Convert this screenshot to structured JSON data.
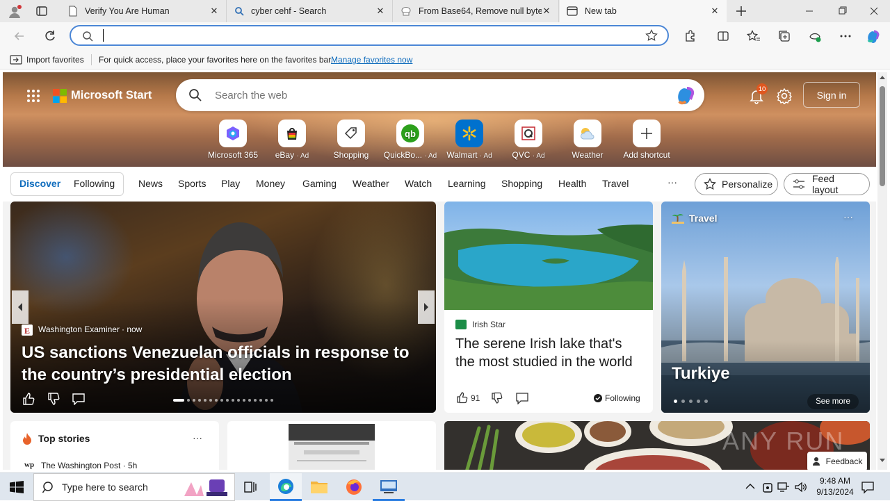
{
  "tabs": [
    {
      "title": "Verify You Are Human"
    },
    {
      "title": "cyber cehf - Search"
    },
    {
      "title": "From Base64, Remove null bytes"
    },
    {
      "title": "New tab"
    }
  ],
  "address": {
    "value": "",
    "placeholder": ""
  },
  "favbar": {
    "import": "Import favorites",
    "hint": "For quick access, place your favorites here on the favorites bar.",
    "manage": "Manage favorites now"
  },
  "start": {
    "brand": "Microsoft Start",
    "search_placeholder": "Search the web",
    "notifications": "10",
    "signin": "Sign in",
    "quicklinks": [
      {
        "label": "Microsoft 365",
        "ad": ""
      },
      {
        "label": "eBay",
        "ad": "· Ad"
      },
      {
        "label": "Shopping",
        "ad": ""
      },
      {
        "label": "QuickBo...",
        "ad": "· Ad"
      },
      {
        "label": "Walmart",
        "ad": "· Ad"
      },
      {
        "label": "QVC",
        "ad": "· Ad"
      },
      {
        "label": "Weather",
        "ad": ""
      },
      {
        "label": "Add shortcut",
        "ad": ""
      }
    ]
  },
  "nav": {
    "discover": "Discover",
    "following": "Following",
    "items": [
      "News",
      "Sports",
      "Play",
      "Money",
      "Gaming",
      "Weather",
      "Watch",
      "Learning",
      "Shopping",
      "Health",
      "Travel"
    ],
    "more": "···",
    "personalize": "Personalize",
    "feed_layout": "Feed layout"
  },
  "hero_card": {
    "source": "Washington Examiner",
    "time": "· now",
    "headline": "US sanctions Venezuelan officials in response to the country’s presidential election"
  },
  "lake_card": {
    "source": "Irish Star",
    "headline": "The serene Irish lake that's the most studied in the world",
    "likes": "91",
    "following": "Following"
  },
  "travel_card": {
    "category": "Travel",
    "title": "Turkiye",
    "see_more": "See more"
  },
  "top_stories": {
    "title": "Top stories",
    "source": "The Washington Post · 5h"
  },
  "feedback": "Feedback",
  "watermark": "ANY RUN",
  "taskbar": {
    "search_placeholder": "Type here to search",
    "time": "9:48 AM",
    "date": "9/13/2024"
  },
  "colors": {
    "accent": "#0f6cbd",
    "link": "#0f6cbd",
    "hero_top": "#7d5534"
  }
}
